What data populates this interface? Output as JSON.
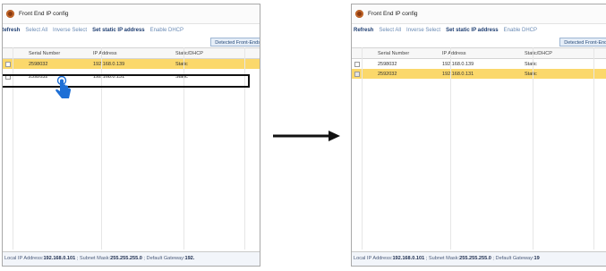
{
  "window": {
    "title": "Front End IP config"
  },
  "menu": {
    "refresh": "Refresh",
    "select_all": "Select All",
    "inverse_select": "Inverse Select",
    "set_static": "Set static IP address",
    "enable_dhcp": "Enable DHCP"
  },
  "detected_button": "Detected Front-Ends",
  "columns": {
    "serial": "Serial Number",
    "ip": "IP Address",
    "mode": "Static/DHCP"
  },
  "left": {
    "rows": [
      {
        "serial": "2598032",
        "ip": "192.168.0.139",
        "mode": "Static",
        "checked": false,
        "selected": true
      },
      {
        "serial": "2592032",
        "ip": "192.168.0.131",
        "mode": "Static",
        "checked": false,
        "selected": false
      }
    ],
    "status": {
      "local_label": "Local IP Address:",
      "local_value": "192.168.0.101",
      "subnet_label": " ; Subnet Mask:",
      "subnet_value": "255.255.255.0",
      "gateway_label": " ; Default Gateway:",
      "gateway_value": "192."
    }
  },
  "right": {
    "rows": [
      {
        "serial": "2598032",
        "ip": "192.168.0.139",
        "mode": "Static",
        "checked": false,
        "selected": false
      },
      {
        "serial": "2592032",
        "ip": "192.168.0.131",
        "mode": "Static",
        "checked": true,
        "selected": true
      }
    ],
    "status": {
      "local_label": "Local IP Address:",
      "local_value": "192.168.0.101",
      "subnet_label": " ; Subnet Mask:",
      "subnet_value": "255.255.255.0",
      "gateway_label": " ; Default Gateway:",
      "gateway_value": "19"
    }
  },
  "colors": {
    "selected_row": "#fbd86b",
    "app_icon": "#8a3b12",
    "cursor": "#1d6fd6",
    "arrow": "#111111"
  },
  "icons": {
    "app": "app-icon",
    "cursor": "hand-pointer-icon",
    "arrow": "arrow-right-icon"
  }
}
